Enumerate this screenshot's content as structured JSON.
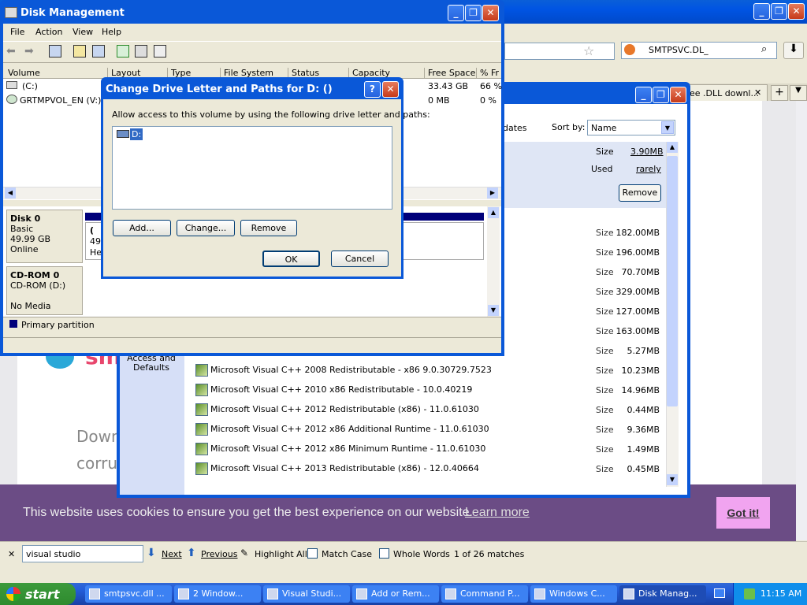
{
  "browser": {
    "search_text": "SMTPSVC.DL_",
    "tab_title": "ee .DLL downl..."
  },
  "page": {
    "text_line1": "Down",
    "text_line2": "corru",
    "logo_text": "sm"
  },
  "cookie": {
    "text": "This website uses cookies to ensure you get the best experience on our website.",
    "link": "Learn more",
    "button": "Got it!"
  },
  "findbar": {
    "query": "visual studio",
    "next": "Next",
    "previous": "Previous",
    "highlight_all": "Highlight All",
    "match_case": "Match Case",
    "whole_words": "Whole Words",
    "matches": "1 of 26 matches"
  },
  "arp": {
    "sort_by_label": "Sort by:",
    "sort_by_value": "Name",
    "updates_label": "dates",
    "left_label": "Access and Defaults",
    "selected": {
      "size_label": "Size",
      "size_value": "3.90MB",
      "used_label": "Used",
      "used_value": "rarely",
      "remove": "Remove"
    },
    "rows": [
      {
        "name": "",
        "size": "182.00MB"
      },
      {
        "name": "",
        "size": "196.00MB"
      },
      {
        "name": "",
        "size": "70.70MB"
      },
      {
        "name": "",
        "size": "329.00MB"
      },
      {
        "name": "",
        "size": "127.00MB"
      },
      {
        "name": "",
        "size": "163.00MB"
      },
      {
        "name": "",
        "size": "5.27MB"
      },
      {
        "name": "Microsoft Visual C++ 2008 Redistributable - x86 9.0.30729.7523",
        "size": "10.23MB"
      },
      {
        "name": "Microsoft Visual C++ 2010  x86 Redistributable - 10.0.40219",
        "size": "14.96MB"
      },
      {
        "name": "Microsoft Visual C++ 2012 Redistributable (x86) - 11.0.61030",
        "size": "0.44MB"
      },
      {
        "name": "Microsoft Visual C++ 2012 x86 Additional Runtime - 11.0.61030",
        "size": "9.36MB"
      },
      {
        "name": "Microsoft Visual C++ 2012 x86 Minimum Runtime - 11.0.61030",
        "size": "1.49MB"
      },
      {
        "name": "Microsoft Visual C++ 2013 Redistributable (x86) - 12.0.40664",
        "size": "0.45MB"
      }
    ],
    "size_label": "Size"
  },
  "dm": {
    "title": "Disk Management",
    "menu": [
      "File",
      "Action",
      "View",
      "Help"
    ],
    "columns": [
      "Volume",
      "Layout",
      "Type",
      "File System",
      "Status",
      "Capacity",
      "Free Space",
      "% Fr"
    ],
    "volumes": [
      {
        "name": "(C:)",
        "free": "33.43 GB",
        "pct": "66 %"
      },
      {
        "name": "GRTMPVOL_EN (V:)",
        "free": "0 MB",
        "pct": "0 %"
      }
    ],
    "disk0": {
      "name": "Disk 0",
      "type": "Basic",
      "size": "49.99 GB",
      "status": "Online"
    },
    "cdrom0": {
      "name": "CD-ROM 0",
      "drive": "CD-ROM (D:)",
      "status": "No Media"
    },
    "partition_peek": [
      "(",
      "49",
      "He"
    ],
    "legend": "Primary partition"
  },
  "dialog": {
    "title": "Change Drive Letter and Paths for D: ()",
    "description": "Allow access to this volume by using the following drive letter and paths:",
    "item": "D:",
    "add": "Add...",
    "change": "Change...",
    "remove": "Remove",
    "ok": "OK",
    "cancel": "Cancel"
  },
  "taskbar": {
    "start": "start",
    "tasks": [
      "smtpsvc.dll ...",
      "2 Window...",
      "Visual Studi...",
      "Add or Rem...",
      "Command P...",
      "Windows C...",
      "Disk Manag..."
    ],
    "clock": "11:15 AM"
  },
  "colors": {
    "titlebar": "#0054e3",
    "cookie_bg": "#6b4c85",
    "cookie_button": "#f1a4f0",
    "taskbar": "#245edb"
  }
}
